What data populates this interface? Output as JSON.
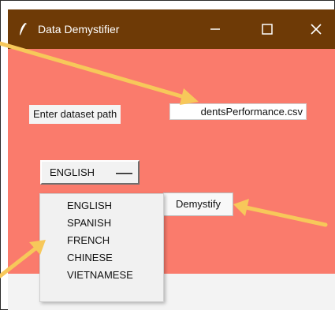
{
  "window": {
    "title": "Data Demystifier"
  },
  "form": {
    "path_label": "Enter dataset path",
    "path_value": "dentsPerformance.csv",
    "language_selected": "ENGLISH",
    "demystify_label": "Demystify"
  },
  "language_menu": {
    "items": [
      "ENGLISH",
      "SPANISH",
      "FRENCH",
      "CHINESE",
      "VIETNAMESE"
    ]
  },
  "colors": {
    "titlebar": "#6e3a06",
    "background": "#fa7b6c",
    "annotation_arrow": "#f7c85a"
  },
  "icons": {
    "app": "feather-icon",
    "minimize": "minimize-icon",
    "maximize": "maximize-icon",
    "close": "close-icon",
    "dropdown": "dropdown-indicator-icon"
  }
}
